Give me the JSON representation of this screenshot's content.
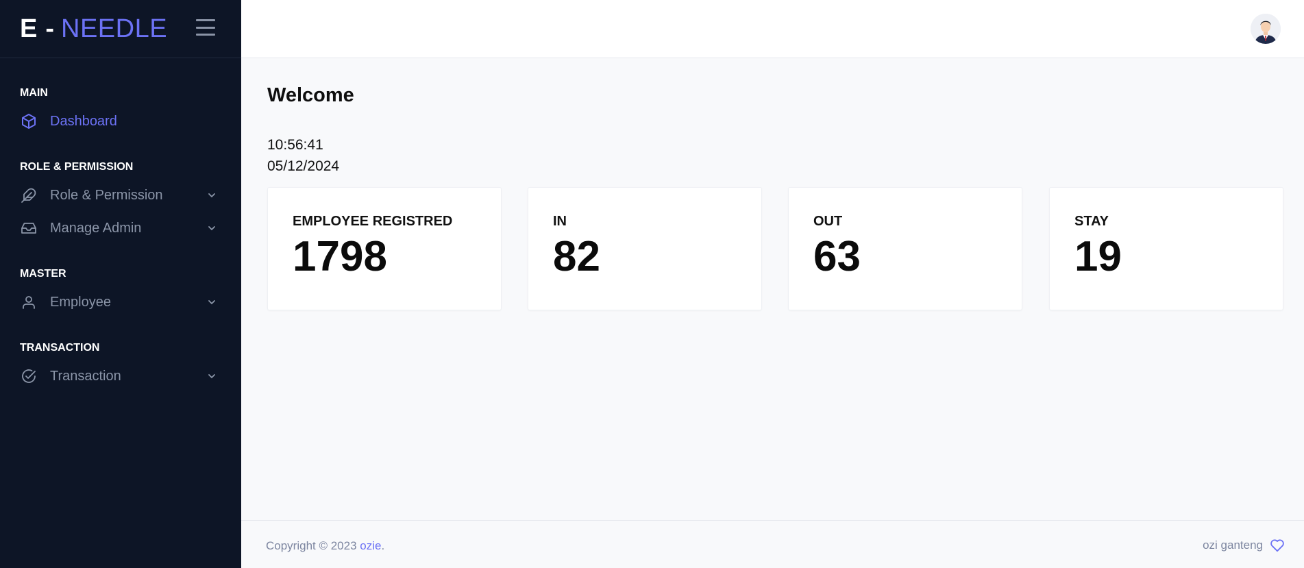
{
  "brand": {
    "part1": "E",
    "dash": "-",
    "part2": "NEEDLE"
  },
  "sidebar": {
    "sections": [
      {
        "title": "MAIN",
        "items": [
          {
            "label": "Dashboard",
            "icon": "cube-icon",
            "active": true
          }
        ]
      },
      {
        "title": "ROLE & PERMISSION",
        "items": [
          {
            "label": "Role & Permission",
            "icon": "feather-icon"
          },
          {
            "label": "Manage Admin",
            "icon": "inbox-icon"
          }
        ]
      },
      {
        "title": "MASTER",
        "items": [
          {
            "label": "Employee",
            "icon": "user-icon"
          }
        ]
      },
      {
        "title": "TRANSACTION",
        "items": [
          {
            "label": "Transaction",
            "icon": "check-circle-icon"
          }
        ]
      }
    ]
  },
  "main": {
    "welcome": "Welcome",
    "time": "10:56:41",
    "date": "05/12/2024",
    "cards": [
      {
        "label": "EMPLOYEE REGISTRED",
        "value": "1798"
      },
      {
        "label": "IN",
        "value": "82"
      },
      {
        "label": "OUT",
        "value": "63"
      },
      {
        "label": "STAY",
        "value": "19"
      }
    ]
  },
  "footer": {
    "copyright_prefix": "Copyright © 2023",
    "copyright_link": "ozie",
    "copyright_suffix": ".",
    "right_text": "ozi ganteng"
  },
  "colors": {
    "sidebar_bg": "#0d1526",
    "accent": "#6c72f5",
    "muted": "#8b95a8"
  }
}
